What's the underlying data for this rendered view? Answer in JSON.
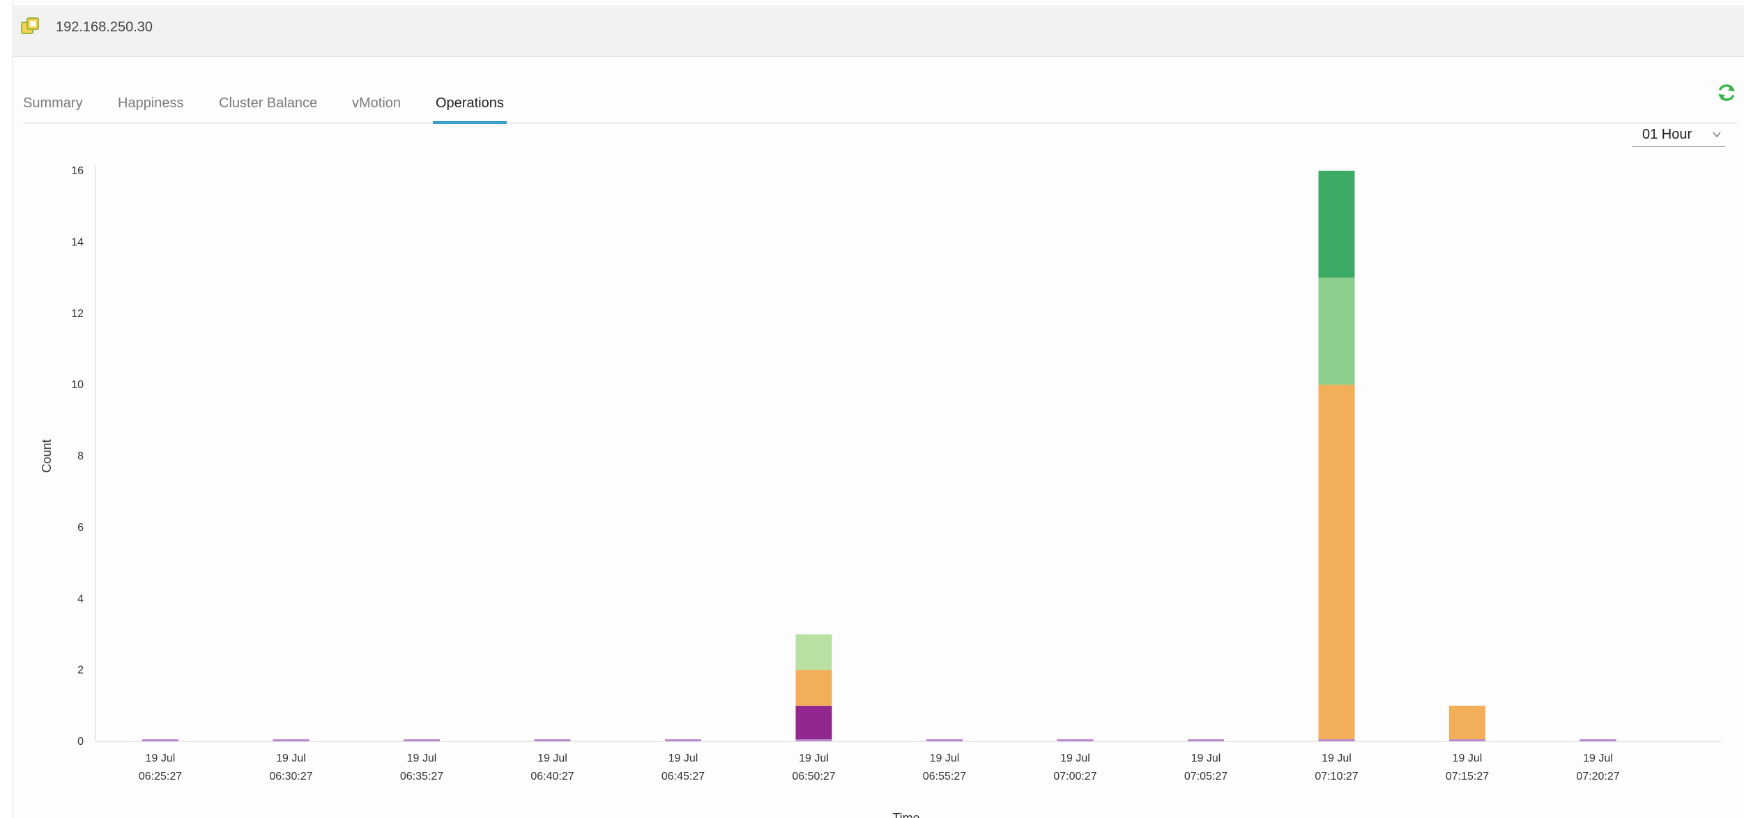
{
  "header": {
    "host": "192.168.250.30",
    "host_icon": "vcenter-host-icon"
  },
  "tabs": [
    {
      "label": "Summary",
      "active": false
    },
    {
      "label": "Happiness",
      "active": false
    },
    {
      "label": "Cluster Balance",
      "active": false
    },
    {
      "label": "vMotion",
      "active": false
    },
    {
      "label": "Operations",
      "active": true
    }
  ],
  "toolbar": {
    "refresh_icon": "refresh-icon",
    "time_range": "01 Hour",
    "time_range_icon": "chevron-down-icon"
  },
  "colors": {
    "accent": "#0a8ec4",
    "refresh": "#3cb44b",
    "series": [
      "#92278f",
      "#f2ae58",
      "#b8e0a0",
      "#8ccf8c",
      "#3dab66"
    ]
  },
  "chart_data": {
    "type": "bar",
    "stacked": true,
    "xlabel": "Time",
    "ylabel": "Count",
    "ylim": [
      0,
      16
    ],
    "yticks": [
      0,
      2,
      4,
      6,
      8,
      10,
      12,
      14,
      16
    ],
    "categories": [
      [
        "19 Jul",
        "06:25:27"
      ],
      [
        "19 Jul",
        "06:30:27"
      ],
      [
        "19 Jul",
        "06:35:27"
      ],
      [
        "19 Jul",
        "06:40:27"
      ],
      [
        "19 Jul",
        "06:45:27"
      ],
      [
        "19 Jul",
        "06:50:27"
      ],
      [
        "19 Jul",
        "06:55:27"
      ],
      [
        "19 Jul",
        "07:00:27"
      ],
      [
        "19 Jul",
        "07:05:27"
      ],
      [
        "19 Jul",
        "07:10:27"
      ],
      [
        "19 Jul",
        "07:15:27"
      ],
      [
        "19 Jul",
        "07:20:27"
      ]
    ],
    "series": [
      {
        "color": "#92278f",
        "values": [
          0,
          0,
          0,
          0,
          0,
          1,
          0,
          0,
          0,
          0,
          0,
          0
        ]
      },
      {
        "color": "#f2ae58",
        "values": [
          0,
          0,
          0,
          0,
          0,
          1,
          0,
          0,
          0,
          10,
          1,
          0
        ]
      },
      {
        "color": "#b8e0a0",
        "values": [
          0,
          0,
          0,
          0,
          0,
          1,
          0,
          0,
          0,
          0,
          0,
          0
        ]
      },
      {
        "color": "#8ccf8c",
        "values": [
          0,
          0,
          0,
          0,
          0,
          0,
          0,
          0,
          0,
          3,
          0,
          0
        ]
      },
      {
        "color": "#3dab66",
        "values": [
          0,
          0,
          0,
          0,
          0,
          0,
          0,
          0,
          0,
          3,
          0,
          0
        ]
      }
    ],
    "zero_marker_color": "#b98ad0",
    "grid": false,
    "legend": "none"
  }
}
